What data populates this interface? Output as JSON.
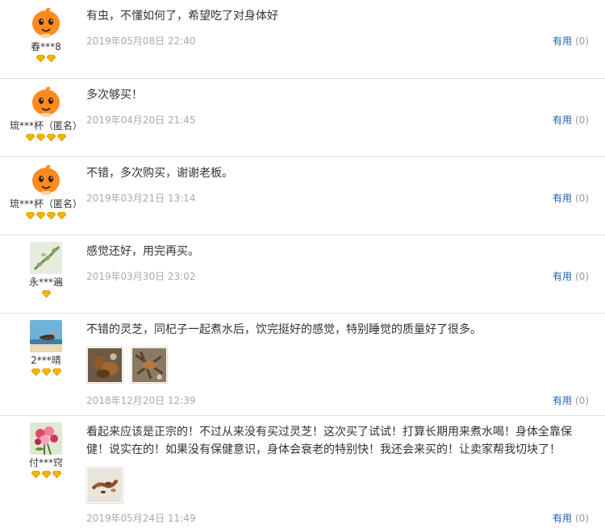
{
  "reviews": [
    {
      "username": "春***8",
      "level": 2,
      "avatar": "orange-mascot-avatar",
      "text": "有虫，不懂如何了，希望吃了对身体好",
      "date": "2019年05月08日 22:40",
      "useful_label": "有用",
      "useful_count": "(0)",
      "images": []
    },
    {
      "username": "琉***杯（匿名）",
      "level": 4,
      "avatar": "orange-mascot-avatar",
      "text": "多次够买！",
      "date": "2019年04月20日 21:45",
      "useful_label": "有用",
      "useful_count": "(0)",
      "images": []
    },
    {
      "username": "琉***杯（匿名）",
      "level": 4,
      "avatar": "orange-mascot-avatar",
      "text": "不错，多次购买，谢谢老板。",
      "date": "2019年03月21日 13:14",
      "useful_label": "有用",
      "useful_count": "(0)",
      "images": []
    },
    {
      "username": "永***遍",
      "level": 1,
      "avatar": "plant-photo-avatar",
      "text": "感觉还好，用完再买。",
      "date": "2019年03月30日 23:02",
      "useful_label": "有用",
      "useful_count": "(0)",
      "images": []
    },
    {
      "username": "2***晴",
      "level": 3,
      "avatar": "person-photo-avatar",
      "text": "不错的灵芝，同杞子一起煮水后，饮完挺好的感觉，特别睡觉的质量好了很多。",
      "date": "2018年12月20日 12:39",
      "useful_label": "有用",
      "useful_count": "(0)",
      "images": [
        "lingzhi-photo-1",
        "lingzhi-photo-2"
      ]
    },
    {
      "username": "付***窍",
      "level": 3,
      "avatar": "flower-photo-avatar",
      "text": "看起来应该是正宗的！不过从来没有买过灵芝！这次买了试试！打算长期用来煮水喝！身体全靠保健！说实在的！如果没有保健意识，身体会衰老的特别快！我还会来买的！让卖家帮我切块了！",
      "date": "2019年05月24日 11:49",
      "useful_label": "有用",
      "useful_count": "(0)",
      "images": [
        "lingzhi-slices-photo"
      ]
    }
  ],
  "colors": {
    "link": "#1a5fb4",
    "muted": "#aaaaaa",
    "gem": "#f5b400",
    "divider": "#e0e0e0"
  }
}
